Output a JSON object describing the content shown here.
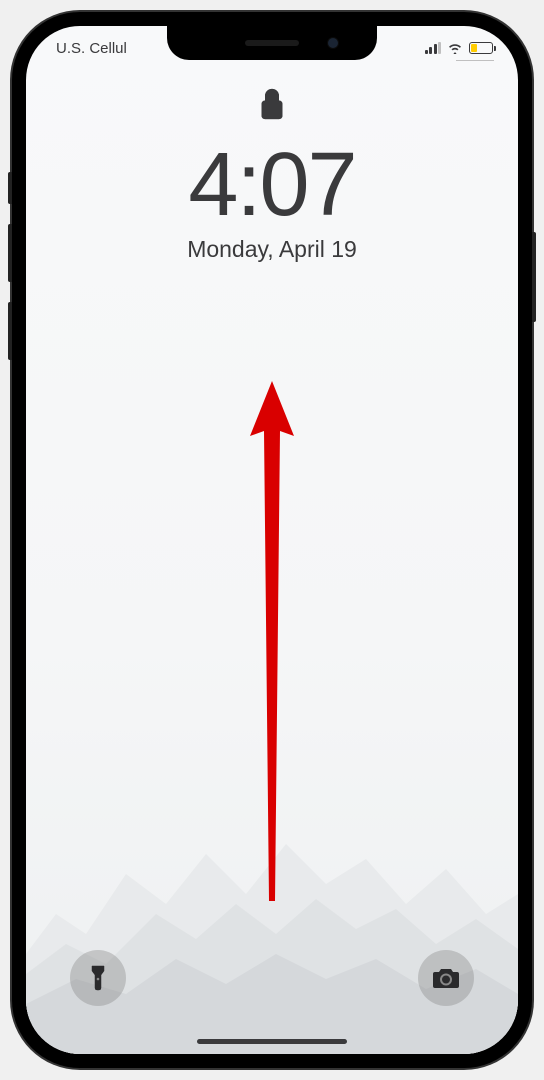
{
  "status_bar": {
    "carrier": "U.S. Cellul",
    "signal_strength": 3,
    "wifi_connected": true,
    "battery_percent": 30,
    "battery_low_power": true
  },
  "lock_screen": {
    "time": "4:07",
    "date": "Monday, April 19"
  },
  "annotation": {
    "type": "swipe-up-arrow",
    "color": "#d90000"
  },
  "quick_actions": {
    "flashlight_icon": "flashlight-icon",
    "camera_icon": "camera-icon"
  }
}
